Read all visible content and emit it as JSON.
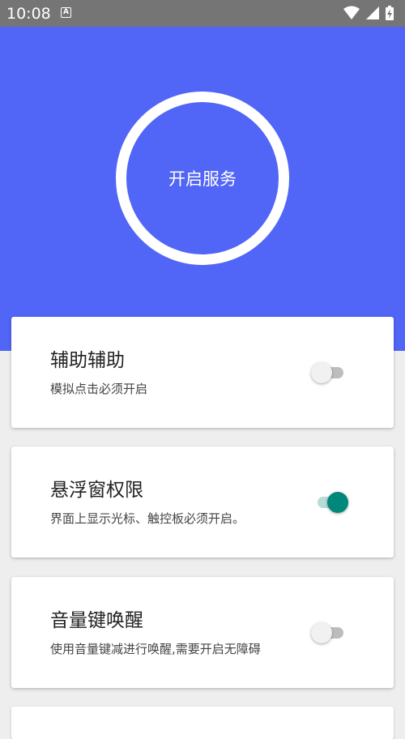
{
  "status_bar": {
    "time": "10:08",
    "app_icon_glyph": "A",
    "icons": [
      "wifi-icon",
      "cell-signal-icon",
      "battery-icon"
    ]
  },
  "hero": {
    "background_color": "#5165f6",
    "button_label": "开启服务"
  },
  "settings": [
    {
      "title": "辅助辅助",
      "description": "模拟点击必须开启",
      "enabled": false
    },
    {
      "title": "悬浮窗权限",
      "description": "界面上显示光标、触控板必须开启。",
      "enabled": true
    },
    {
      "title": "音量键唤醒",
      "description": "使用音量键减进行唤醒,需要开启无障碍",
      "enabled": false
    }
  ],
  "colors": {
    "accent": "#00897b",
    "switch_on_track": "#b5dcd7",
    "switch_off_track": "#bdbdbd"
  }
}
